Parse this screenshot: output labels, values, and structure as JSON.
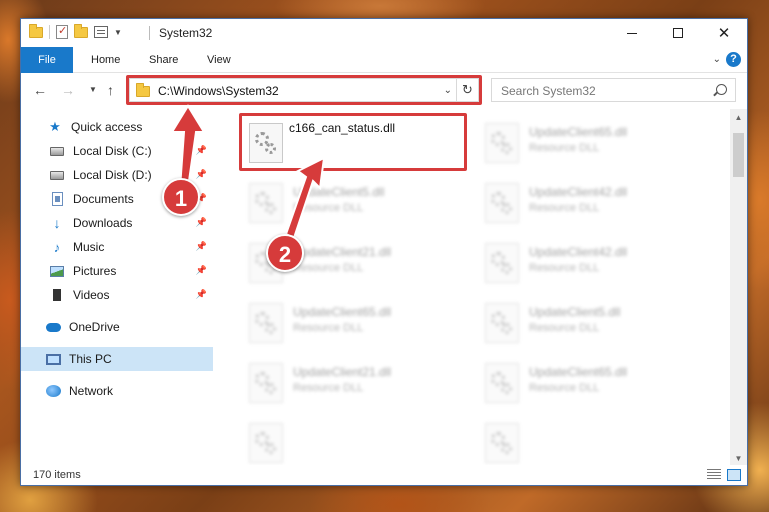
{
  "window": {
    "title": "System32",
    "item_count": "170 items"
  },
  "ribbon": {
    "tabs": [
      "File",
      "Home",
      "Share",
      "View"
    ]
  },
  "address": {
    "path": "C:\\Windows\\System32",
    "search_placeholder": "Search System32"
  },
  "sidebar": {
    "items": [
      {
        "label": "Quick access",
        "icon": "star-icon",
        "pinned": false
      },
      {
        "label": "Local Disk (C:)",
        "icon": "disk-icon",
        "pinned": true
      },
      {
        "label": "Local Disk (D:)",
        "icon": "disk-icon",
        "pinned": true
      },
      {
        "label": "Documents",
        "icon": "documents-icon",
        "pinned": true
      },
      {
        "label": "Downloads",
        "icon": "downloads-icon",
        "pinned": true
      },
      {
        "label": "Music",
        "icon": "music-icon",
        "pinned": true
      },
      {
        "label": "Pictures",
        "icon": "pictures-icon",
        "pinned": true
      },
      {
        "label": "Videos",
        "icon": "videos-icon",
        "pinned": true
      },
      {
        "label": "OneDrive",
        "icon": "onedrive-icon",
        "pinned": false
      },
      {
        "label": "This PC",
        "icon": "this-pc-icon",
        "pinned": false,
        "selected": true
      },
      {
        "label": "Network",
        "icon": "network-icon",
        "pinned": false
      }
    ]
  },
  "files": {
    "highlighted": {
      "name": "c166_can_status.dll"
    },
    "blurred": [
      {
        "name": "UpdateClient65.dll",
        "type": "Resource DLL"
      },
      {
        "name": "UpdateClient5.dll",
        "type": "Resource DLL"
      },
      {
        "name": "UpdateClient42.dll",
        "type": "Resource DLL"
      },
      {
        "name": "UpdateClient21.dll",
        "type": "Resource DLL"
      },
      {
        "name": "UpdateClient42.dll",
        "type": "Resource DLL"
      },
      {
        "name": "UpdateClient65.dll",
        "type": "Resource DLL"
      },
      {
        "name": "UpdateClient5.dll",
        "type": "Resource DLL"
      },
      {
        "name": "UpdateClient21.dll",
        "type": "Resource DLL"
      },
      {
        "name": "UpdateClient65.dll",
        "type": "Resource DLL"
      }
    ]
  },
  "annotations": {
    "step1": "1",
    "step2": "2",
    "color": "#d63b3b"
  }
}
